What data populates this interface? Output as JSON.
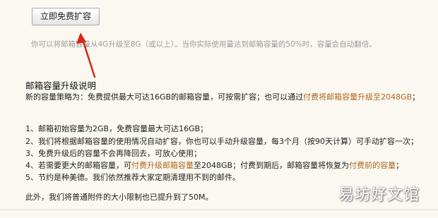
{
  "upgrade": {
    "button_label": "立即免费扩容",
    "hint": "你可以将邮箱容量从4G升级至8G（或以上）。当你实际使用量达到邮箱容量的50%时，容量会自动翻倍。"
  },
  "description": {
    "title": "邮箱容量升级说明",
    "strategy_prefix": "新的容量策略为：免费提供最大可达16GB的邮箱容量，可按需扩容；也可以通过",
    "strategy_link": "付费将邮箱容量升级至2048GB",
    "strategy_suffix": "；",
    "item1": "1、邮箱初始容量为2GB，免费容量最大可达16GB；",
    "item2": "2、我们将根据邮箱容量的使用情况自动扩容，你也可以手动升级容量，每3个月（按90天计算）可手动扩容一次；",
    "item3": "3、免费升级后的容量不会再降回去，可放心使用；",
    "item4_prefix": "4、若需要更大的邮箱容量，可",
    "item4_link": "付费升级邮箱容量",
    "item4_mid": "至2048GB；付费到期后，邮箱容量将恢复为",
    "item4_link2": "付费前的容量",
    "item4_suffix": "；",
    "item5": "5、节约是种美德。我们依然推荐大家定期清理用不到的邮件。",
    "attachment_note": "此外，我们将普通附件的大小限制也已提升到了50M。"
  },
  "watermark": "易坊好文馆",
  "colors": {
    "background": "#fbf8f1",
    "highlight": "#b0661e",
    "arrow": "#d9261c",
    "hint": "#9d9d9d"
  }
}
